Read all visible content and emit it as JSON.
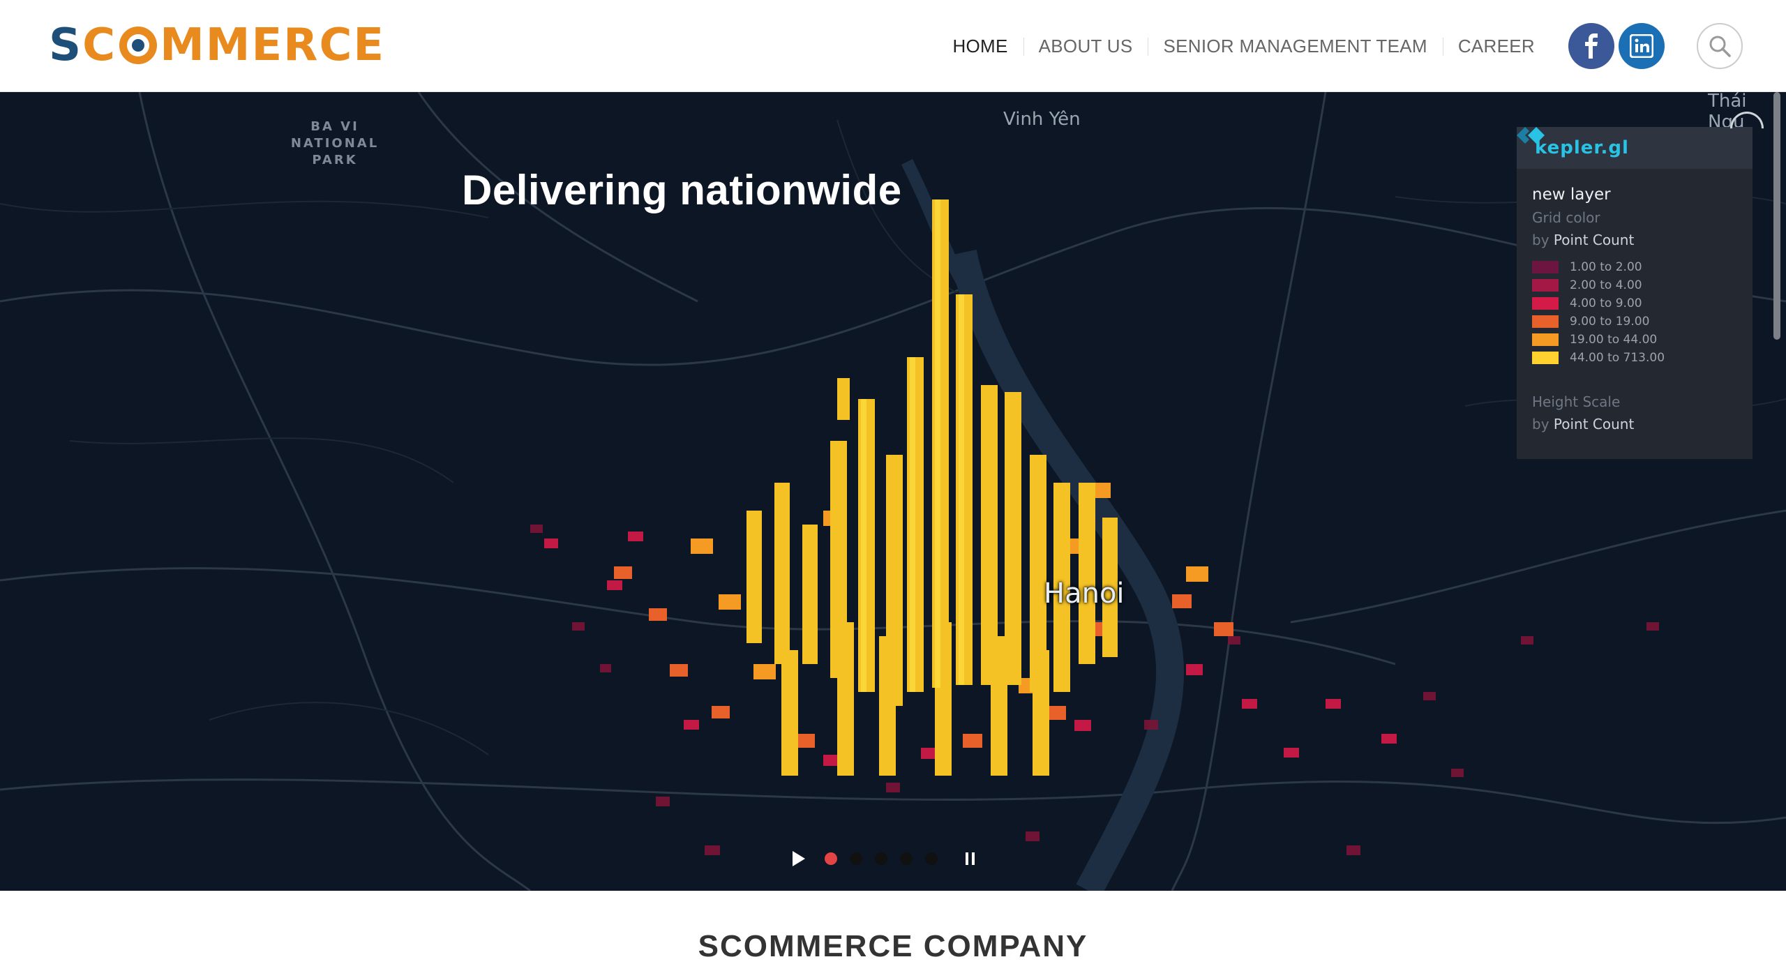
{
  "header": {
    "logo_text": "SCOMMERCE",
    "nav": [
      {
        "label": "HOME",
        "active": true
      },
      {
        "label": "ABOUT US",
        "active": false
      },
      {
        "label": "SENIOR MANAGEMENT TEAM",
        "active": false
      },
      {
        "label": "CAREER",
        "active": false
      }
    ],
    "social": [
      {
        "icon": "facebook-icon",
        "color": "#3b5998"
      },
      {
        "icon": "linkedin-icon",
        "color": "#1b6fb4"
      }
    ],
    "search_icon": "search-icon"
  },
  "hero": {
    "title": "Delivering nationwide",
    "map_labels": {
      "park": "BA VI NATIONAL PARK",
      "city1": "Vinh Yên",
      "city2": "Thái Ngu",
      "hanoi": "Hanoi"
    },
    "kepler": {
      "brand": "kepler.gl",
      "layer_title": "new layer",
      "grid_color_label": "Grid color",
      "by_prefix": "by",
      "grid_field": "Point Count",
      "legend": [
        {
          "label": "1.00 to 2.00",
          "color": "#6b1540"
        },
        {
          "label": "2.00 to 4.00",
          "color": "#a31845"
        },
        {
          "label": "4.00 to 9.00",
          "color": "#d41a46"
        },
        {
          "label": "9.00 to 19.00",
          "color": "#e8602a"
        },
        {
          "label": "19.00 to 44.00",
          "color": "#f59a22"
        },
        {
          "label": "44.00 to 713.00",
          "color": "#ffd230"
        }
      ],
      "height_scale_label": "Height Scale",
      "height_field": "Point Count"
    },
    "slider": {
      "slides": 5,
      "active_index": 0
    }
  },
  "section": {
    "title": "SCOMMERCE COMPANY"
  }
}
